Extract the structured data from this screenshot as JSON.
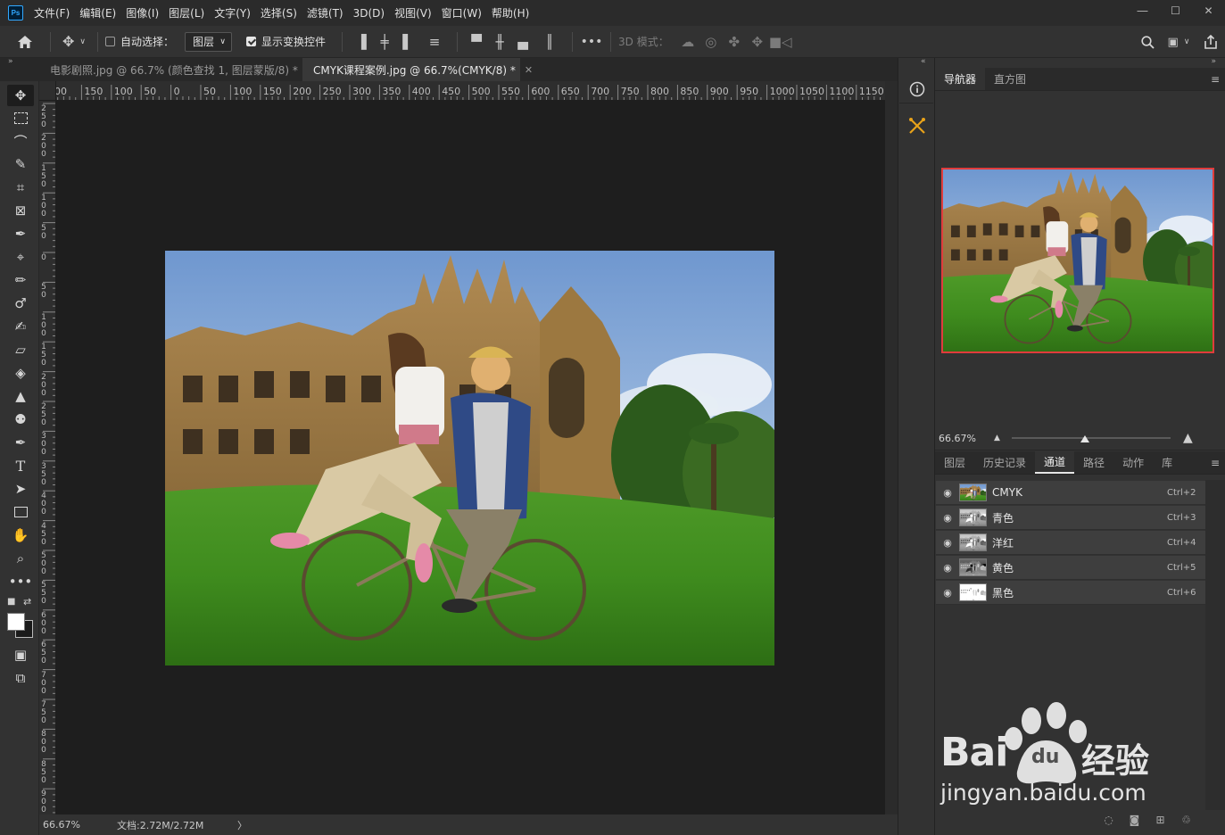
{
  "app": {
    "logo": "Ps"
  },
  "menu": [
    "文件(F)",
    "编辑(E)",
    "图像(I)",
    "图层(L)",
    "文字(Y)",
    "选择(S)",
    "滤镜(T)",
    "3D(D)",
    "视图(V)",
    "窗口(W)",
    "帮助(H)"
  ],
  "options": {
    "auto_select_label": "自动选择：",
    "auto_select_checked": false,
    "layer_select_value": "图层",
    "show_transform_label": "显示变换控件",
    "show_transform_checked": true,
    "mode_3d_label": "3D 模式："
  },
  "tabs": [
    {
      "label": "电影剧照.jpg @ 66.7% (颜色查找 1, 图层蒙版/8) *",
      "active": false
    },
    {
      "label": "CMYK课程案例.jpg @ 66.7%(CMYK/8) *",
      "active": true
    }
  ],
  "ruler_top": [
    "00",
    "150",
    "100",
    "50",
    "0",
    "50",
    "100",
    "150",
    "200",
    "250",
    "300",
    "350",
    "400",
    "450",
    "500",
    "550",
    "600",
    "650",
    "700",
    "750",
    "800",
    "850",
    "900",
    "950",
    "1000",
    "1050",
    "1100",
    "1150",
    "1"
  ],
  "ruler_left": [
    "250",
    "200",
    "150",
    "100",
    "50",
    "0",
    "50",
    "100",
    "150",
    "200",
    "250",
    "300",
    "350",
    "400",
    "450",
    "500",
    "550",
    "600",
    "650",
    "700",
    "750",
    "800",
    "850",
    "900"
  ],
  "status": {
    "zoom": "66.67%",
    "doc": "文档:2.72M/2.72M",
    "arrow": "〉"
  },
  "navigator": {
    "tabs": [
      "导航器",
      "直方图"
    ],
    "zoom": "66.67%",
    "zoom_slider": 0.46
  },
  "channels_panel": {
    "tabs": [
      "图层",
      "历史记录",
      "通道",
      "路径",
      "动作",
      "库"
    ],
    "active_tab": "通道",
    "channels": [
      {
        "name": "CMYK",
        "shortcut": "Ctrl+2",
        "thumb": "color"
      },
      {
        "name": "青色",
        "shortcut": "Ctrl+3",
        "thumb": "gray"
      },
      {
        "name": "洋红",
        "shortcut": "Ctrl+4",
        "thumb": "gray"
      },
      {
        "name": "黄色",
        "shortcut": "Ctrl+5",
        "thumb": "dark"
      },
      {
        "name": "黑色",
        "shortcut": "Ctrl+6",
        "thumb": "light"
      }
    ]
  },
  "watermark": {
    "brand_left": "Bai",
    "brand_right": "经验",
    "paw": "du",
    "url": "jingyan.baidu.com"
  },
  "colors": {
    "accent_red": "#e03c3c",
    "panel_bg": "#323232",
    "canvas_bg": "#1e1e1e"
  }
}
